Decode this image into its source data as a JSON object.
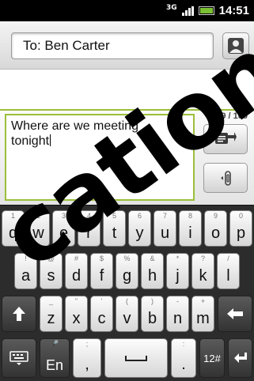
{
  "status_bar": {
    "network": "3G",
    "time": "14:51"
  },
  "recipient": {
    "value": "To: Ben  Carter"
  },
  "compose": {
    "message_line1": "Where are we meeting",
    "message_line2": "tonight",
    "char_counter": "29 / 160"
  },
  "keyboard": {
    "row1": [
      {
        "main": "q",
        "alt": "1"
      },
      {
        "main": "w",
        "alt": "2"
      },
      {
        "main": "e",
        "alt": "3"
      },
      {
        "main": "r",
        "alt": "4"
      },
      {
        "main": "t",
        "alt": "5"
      },
      {
        "main": "y",
        "alt": "6"
      },
      {
        "main": "u",
        "alt": "7"
      },
      {
        "main": "i",
        "alt": "8"
      },
      {
        "main": "o",
        "alt": "9"
      },
      {
        "main": "p",
        "alt": "0"
      }
    ],
    "row2": [
      {
        "main": "a",
        "alt": "!"
      },
      {
        "main": "s",
        "alt": "@"
      },
      {
        "main": "d",
        "alt": "#"
      },
      {
        "main": "f",
        "alt": "$"
      },
      {
        "main": "g",
        "alt": "%"
      },
      {
        "main": "h",
        "alt": "&"
      },
      {
        "main": "j",
        "alt": "*"
      },
      {
        "main": "k",
        "alt": "?"
      },
      {
        "main": "l",
        "alt": "/"
      }
    ],
    "row3": [
      {
        "main": "z",
        "alt": "_"
      },
      {
        "main": "x",
        "alt": "\""
      },
      {
        "main": "c",
        "alt": "'"
      },
      {
        "main": "v",
        "alt": "("
      },
      {
        "main": "b",
        "alt": ")"
      },
      {
        "main": "n",
        "alt": "-"
      },
      {
        "main": "m",
        "alt": "+"
      }
    ],
    "lang_key": "En",
    "comma_key": ",",
    "comma_alt": ";",
    "period_key": ".",
    "period_alt": ":",
    "symbols_key": "12#"
  },
  "watermark_text": "cation",
  "colors": {
    "accent_green": "#9bbf3a",
    "battery_green": "#7bbf33"
  }
}
